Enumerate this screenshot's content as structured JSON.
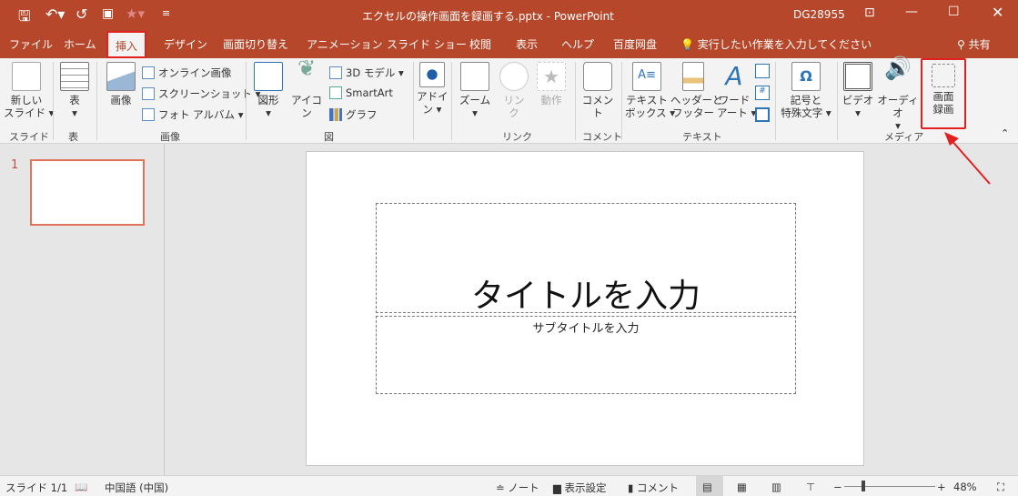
{
  "window": {
    "title": "エクセルの操作画面を録画する.pptx  -  PowerPoint",
    "user": "DG28955",
    "accent": "#b7472a",
    "highlight": "#e32020"
  },
  "quick_access": [
    "save-icon",
    "undo-icon",
    "redo-icon",
    "present-icon",
    "star-icon",
    "customize-icon"
  ],
  "tabs": [
    "ファイル",
    "ホーム",
    "挿入",
    "デザイン",
    "画面切り替え",
    "アニメーション",
    "スライド ショー",
    "校閲",
    "表示",
    "ヘルプ",
    "百度网盘"
  ],
  "active_tab": "挿入",
  "tell_me": "実行したい作業を入力してください",
  "share": "共有",
  "ribbon": {
    "new_slide": "新しい\nスライド ▾",
    "table": "表",
    "picture": "画像",
    "online_picture": "オンライン画像",
    "screenshot": "スクリーンショット ▾",
    "photo_album": "フォト アルバム ▾",
    "shapes": "図形",
    "icons": "アイコン",
    "model3d": "3D モデル ▾",
    "smartart": "SmartArt",
    "chart": "グラフ",
    "addins": "アドイ\nン ▾",
    "zoom": "ズーム",
    "link": "リン\nク",
    "action": "動作",
    "comment": "コメント",
    "textbox": "テキスト\nボックス ▾",
    "header_footer": "ヘッダーと\nフッター",
    "wordart": "ワード\nアート ▾",
    "symbols": "記号と\n特殊文字 ▾",
    "video": "ビデオ",
    "audio": "オーディオ",
    "screen_recording": "画面\n録画",
    "groups": {
      "slides": "スライド",
      "tables": "表",
      "images": "画像",
      "illustrations": "図",
      "links": "リンク",
      "comments": "コメント",
      "text": "テキスト",
      "media": "メディア"
    }
  },
  "slide_pane": {
    "number": "1"
  },
  "slide": {
    "title_placeholder": "タイトルを入力",
    "subtitle_placeholder": "サブタイトルを入力"
  },
  "status": {
    "slide": "スライド 1/1",
    "language": "中国語 (中国)",
    "notes": "ノート",
    "display": "表示設定",
    "comments": "コメント",
    "zoom": "48%",
    "zoom_percent": 48
  }
}
